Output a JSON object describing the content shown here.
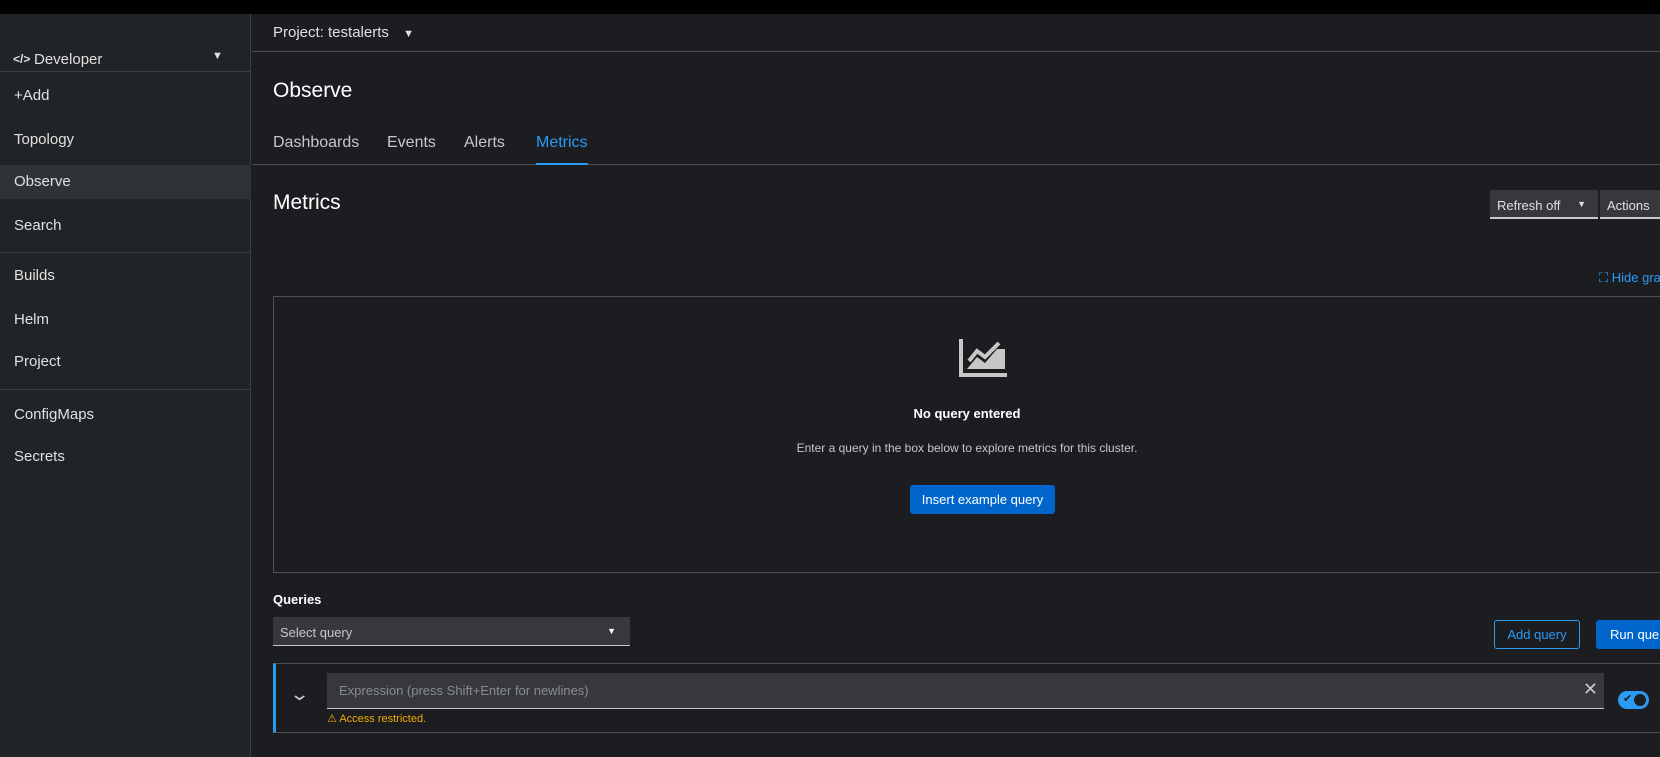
{
  "perspective": {
    "label": "Developer"
  },
  "sidebar": {
    "items": [
      {
        "label": "+Add"
      },
      {
        "label": "Topology"
      },
      {
        "label": "Observe"
      },
      {
        "label": "Search"
      },
      {
        "label": "Builds"
      },
      {
        "label": "Helm"
      },
      {
        "label": "Project"
      },
      {
        "label": "ConfigMaps"
      },
      {
        "label": "Secrets"
      }
    ]
  },
  "project": {
    "label": "Project: testalerts"
  },
  "page": {
    "title": "Observe",
    "tabs": [
      {
        "label": "Dashboards"
      },
      {
        "label": "Events"
      },
      {
        "label": "Alerts"
      },
      {
        "label": "Metrics"
      }
    ]
  },
  "metrics": {
    "title": "Metrics",
    "refresh": "Refresh off",
    "actions": "Actions",
    "hide_graph": "Hide graph",
    "empty_title": "No query entered",
    "empty_desc": "Enter a query in the box below to explore metrics for this cluster.",
    "insert_example": "Insert example query",
    "queries_label": "Queries",
    "select_query": "Select query",
    "add_query": "Add query",
    "run_queries": "Run queries",
    "expression_placeholder": "Expression (press Shift+Enter for newlines)",
    "access_restricted": "Access restricted."
  },
  "colors": {
    "accent": "#2b9af3",
    "primary": "#0066cc",
    "warning": "#f0ab00"
  }
}
